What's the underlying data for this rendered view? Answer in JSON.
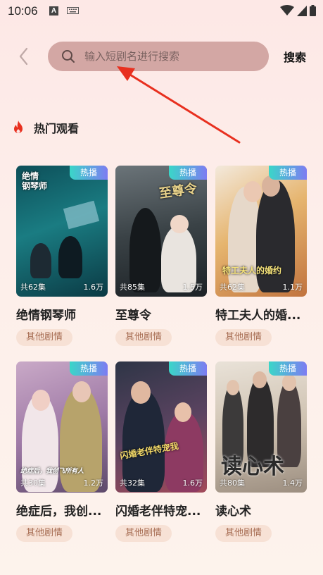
{
  "status": {
    "time": "10:06",
    "a_icon": "A"
  },
  "header": {
    "search_placeholder": "输入短剧名进行搜索",
    "search_label": "搜索"
  },
  "section": {
    "title": "热门观看"
  },
  "dramas": [
    {
      "title": "绝情钢琴师",
      "episodes": "共62集",
      "views": "1.6万",
      "badge": "热播",
      "tag": "其他剧情",
      "poster_text": "绝情\n钢琴师"
    },
    {
      "title": "至尊令",
      "episodes": "共85集",
      "views": "1.5万",
      "badge": "热播",
      "tag": "其他剧情",
      "poster_text": "至尊令"
    },
    {
      "title": "特工夫人的婚...",
      "episodes": "共62集",
      "views": "1.1万",
      "badge": "热播",
      "tag": "其他剧情",
      "poster_text": "特工夫人的婚约"
    },
    {
      "title": "绝症后，我创...",
      "episodes": "共30集",
      "views": "1.2万",
      "badge": "热播",
      "tag": "其他剧情",
      "poster_text": "绝症后，我创飞所有人"
    },
    {
      "title": "闪婚老伴特宠...",
      "episodes": "共32集",
      "views": "1.6万",
      "badge": "热播",
      "tag": "其他剧情",
      "poster_text": "闪婚老伴特宠我"
    },
    {
      "title": "读心术",
      "episodes": "共80集",
      "views": "1.4万",
      "badge": "热播",
      "tag": "其他剧情",
      "poster_text": "读心术"
    }
  ],
  "colors": {
    "accent_red": "#e8301f",
    "search_bg": "#d3a7a4",
    "tag_bg": "#f7e1d5",
    "tag_text": "#a66c52"
  }
}
